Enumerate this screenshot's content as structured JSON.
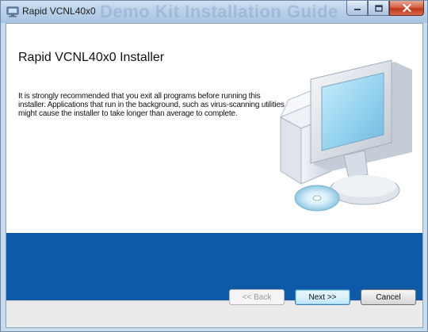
{
  "window": {
    "title": "Rapid VCNL40x0",
    "watermark": "Demo Kit Installation Guide"
  },
  "installer": {
    "heading": "Rapid VCNL40x0 Installer",
    "message": "It is strongly recommended that you exit all programs before running this installer. Applications that run in the background, such as virus-scanning utilities, might cause the installer to take longer than average to complete."
  },
  "buttons": {
    "back": "<< Back",
    "next": "Next >>",
    "cancel": "Cancel"
  },
  "colors": {
    "band": "#0f5aa8",
    "footer": "#eaeaea"
  },
  "icons": {
    "app": "installer-app-icon",
    "minimize": "minimize-icon",
    "maximize": "maximize-icon",
    "close": "close-icon",
    "illustration": "computer-setup-illustration"
  }
}
